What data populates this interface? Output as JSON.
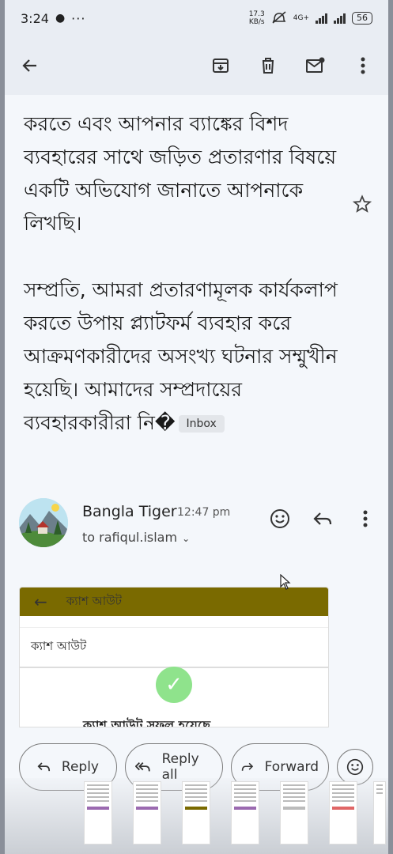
{
  "status_bar": {
    "time": "3:24",
    "network_speed_top": "17.3",
    "network_speed_bottom": "KB/s",
    "network_type": "4G+",
    "battery": "56"
  },
  "app_bar": {
    "back_icon": "arrow-left-icon",
    "actions": [
      "archive-icon",
      "delete-icon",
      "mark-unread-icon",
      "more-vert-icon"
    ]
  },
  "email": {
    "body_paragraphs": [
      "করতে এবং আপনার ব্যাঙ্কের বিশদ ব্যবহারের সাথে জড়িত প্রতারণার বিষয়ে একটি অভিযোগ জানাতে আপনাকে লিখছি।",
      "সম্প্রতি, আমরা প্রতারণামূলক কার্যকলাপ করতে উপায় প্ল্যাটফর্ম ব্যবহার করে আক্রমণকারীদের অসংখ্য ঘটনার সম্মুখীন হয়েছি। আমাদের সম্প্রদায়ের ব্যবহারকারীরা নি�"
    ],
    "label_chip": "Inbox"
  },
  "sender": {
    "name": "Bangla Tiger",
    "time": "12:47 pm",
    "to": "to rafiqul.islam"
  },
  "attachment": {
    "header_title": "ক্যাশ আউট",
    "subtitle": "ক্যাশ আউট",
    "success_text": "ক্যাশ আউট সফল হয়েছে"
  },
  "buttons": {
    "reply": "Reply",
    "reply_all": "Reply all",
    "forward": "Forward"
  },
  "colors": {
    "background": "#f4f7fb",
    "attachment_header": "#7a6a00",
    "success_green": "#8fe38c"
  }
}
